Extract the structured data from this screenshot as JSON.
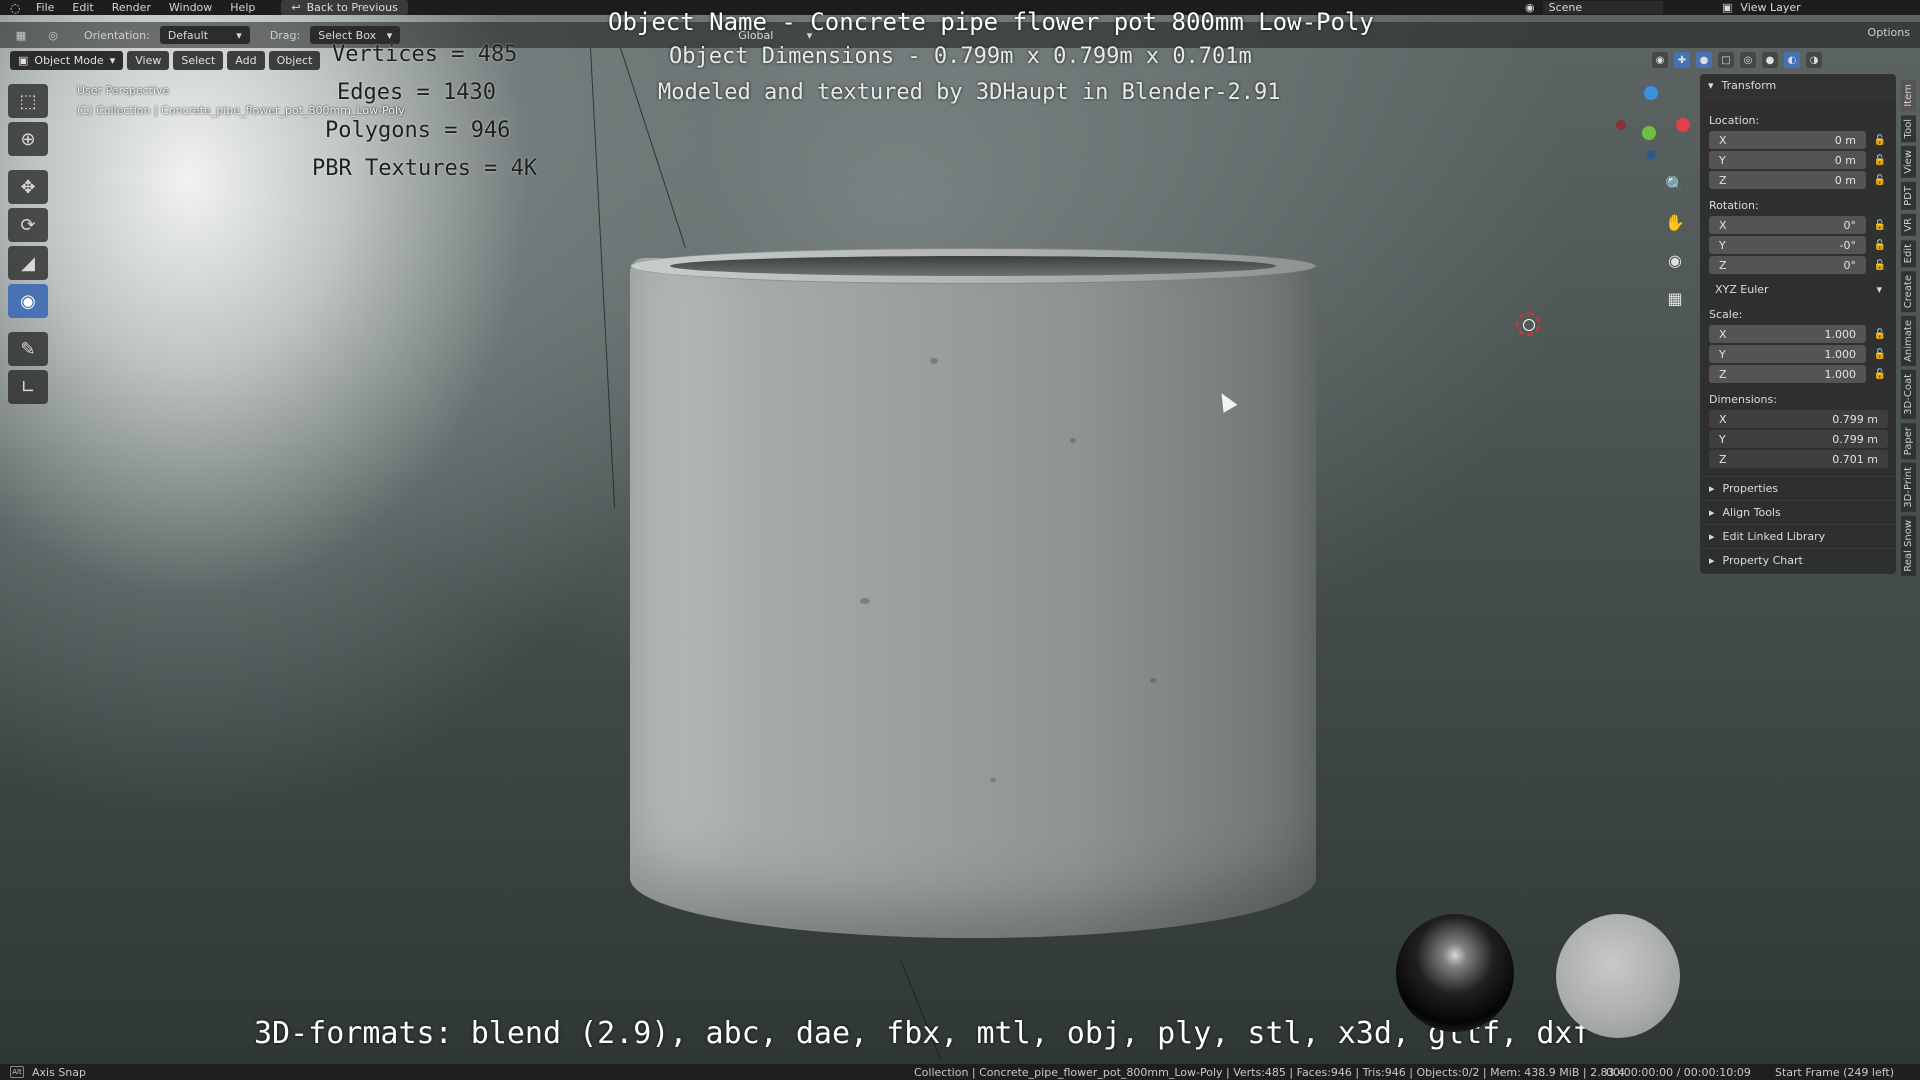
{
  "topbar": {
    "menus": [
      "File",
      "Edit",
      "Render",
      "Window",
      "Help"
    ],
    "back_button": "Back to Previous",
    "scene_label": "Scene",
    "view_layer_label": "View Layer"
  },
  "toolbar": {
    "orientation_label": "Orientation:",
    "orientation_value": "Default",
    "drag_label": "Drag:",
    "drag_value": "Select Box",
    "transform_orientation": "Global",
    "options_label": "Options"
  },
  "header": {
    "mode": "Object Mode",
    "menus": [
      "View",
      "Select",
      "Add",
      "Object"
    ]
  },
  "viewport": {
    "perspective_label": "User Perspective",
    "collection_label": "(1) Collection | Concrete_pipe_flower_pot_800mm_Low-Poly"
  },
  "overlay": {
    "title": "Object Name - Concrete pipe flower pot 800mm Low-Poly",
    "vertices": "Vertices = 485",
    "edges": "Edges = 1430",
    "polygons": "Polygons = 946",
    "textures": "PBR Textures = 4K",
    "dimensions": "Object Dimensions -  0.799m x 0.799m x 0.701m",
    "modeled_by": "Modeled and textured by 3DHaupt in Blender-2.91",
    "formats": "3D-formats: blend (2.9), abc, dae, fbx, mtl, obj, ply, stl, x3d, gltf, dxf"
  },
  "npanel": {
    "section_title": "Transform",
    "location_label": "Location:",
    "location": [
      {
        "axis": "X",
        "value": "0 m"
      },
      {
        "axis": "Y",
        "value": "0 m"
      },
      {
        "axis": "Z",
        "value": "0 m"
      }
    ],
    "rotation_label": "Rotation:",
    "rotation": [
      {
        "axis": "X",
        "value": "0°"
      },
      {
        "axis": "Y",
        "value": "-0°"
      },
      {
        "axis": "Z",
        "value": "0°"
      }
    ],
    "rotation_mode": "XYZ Euler",
    "scale_label": "Scale:",
    "scale": [
      {
        "axis": "X",
        "value": "1.000"
      },
      {
        "axis": "Y",
        "value": "1.000"
      },
      {
        "axis": "Z",
        "value": "1.000"
      }
    ],
    "dimensions_label": "Dimensions:",
    "dimensions": [
      {
        "axis": "X",
        "value": "0.799 m"
      },
      {
        "axis": "Y",
        "value": "0.799 m"
      },
      {
        "axis": "Z",
        "value": "0.701 m"
      }
    ],
    "collapsed_sections": [
      "Properties",
      "Align Tools",
      "Edit Linked Library",
      "Property Chart"
    ]
  },
  "sidebar_tabs": [
    "Item",
    "Tool",
    "View",
    "PDT",
    "VR",
    "Edit",
    "Create",
    "Animate",
    "3D-Coat",
    "Paper",
    "3D-Print",
    "Real Snow"
  ],
  "statusbar": {
    "key_hint": "Alt",
    "left_text": "Axis Snap",
    "info": "Collection | Concrete_pipe_flower_pot_800mm_Low-Poly | Verts:485 | Faces:946 | Tris:946 | Objects:0/2 | Mem: 438.9 MiB | 2.83.4",
    "time": "00:00:00:00 / 00:00:10:09",
    "frame": "Start Frame (249 left)"
  },
  "colors": {
    "active_tool": "#4772b3",
    "axis_x": "#e0404a",
    "axis_y": "#6fbf40",
    "axis_z": "#3d8fe0",
    "cursor_3d": "#e03030"
  }
}
